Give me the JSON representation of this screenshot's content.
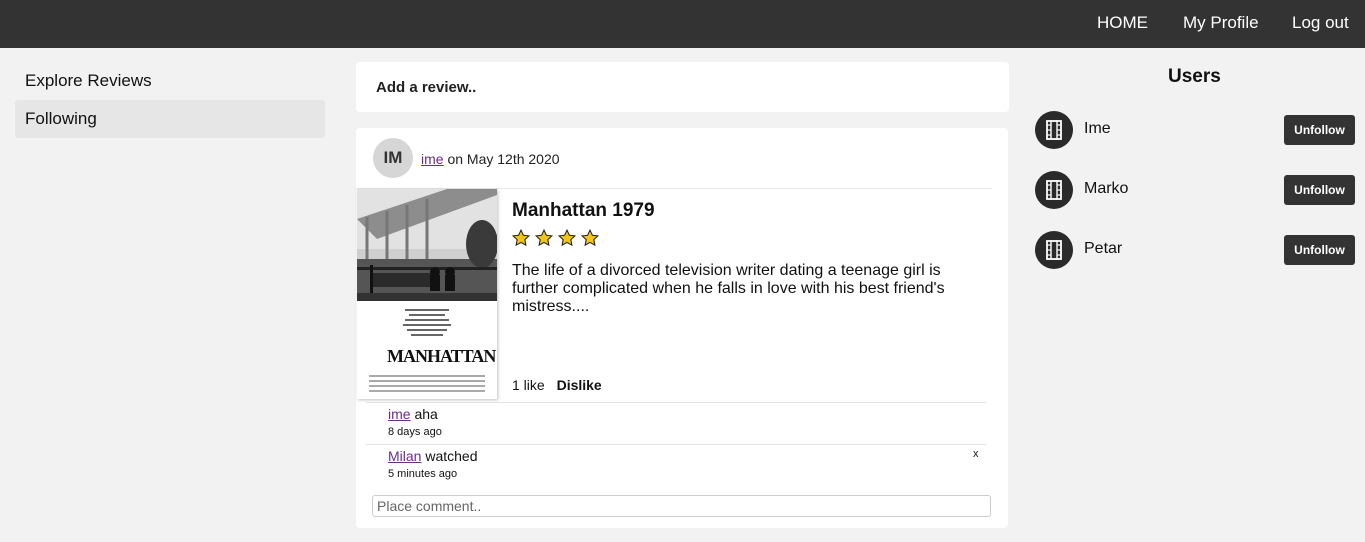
{
  "nav": {
    "home": "HOME",
    "profile": "My Profile",
    "logout": "Log out"
  },
  "sidebar": {
    "items": [
      {
        "label": "Explore Reviews"
      },
      {
        "label": "Following"
      }
    ]
  },
  "add_review": {
    "label": "Add a review.."
  },
  "review": {
    "avatar_initials": "IM",
    "author": "ime",
    "date_text": "on May 12th 2020",
    "poster_text": "MANHATTAN",
    "movie_title": "Manhattan 1979",
    "rating": 4,
    "description": "The life of a divorced television writer dating a teenage girl is further complicated when he falls in love with his best friend's mistress....",
    "likes": "1 like",
    "dislike_label": "Dislike",
    "comments": [
      {
        "author": "ime",
        "text": "aha",
        "time": "8 days ago"
      },
      {
        "author": "Milan",
        "text": "watched",
        "time": "5 minutes ago",
        "close": "x"
      }
    ],
    "comment_placeholder": "Place comment.."
  },
  "users": {
    "title": "Users",
    "list": [
      {
        "name": "Ime",
        "button": "Unfollow"
      },
      {
        "name": "Marko",
        "button": "Unfollow"
      },
      {
        "name": "Petar",
        "button": "Unfollow"
      }
    ]
  },
  "colors": {
    "topbar": "#333333",
    "link": "#6a2e8a",
    "star": "#f2c318"
  }
}
